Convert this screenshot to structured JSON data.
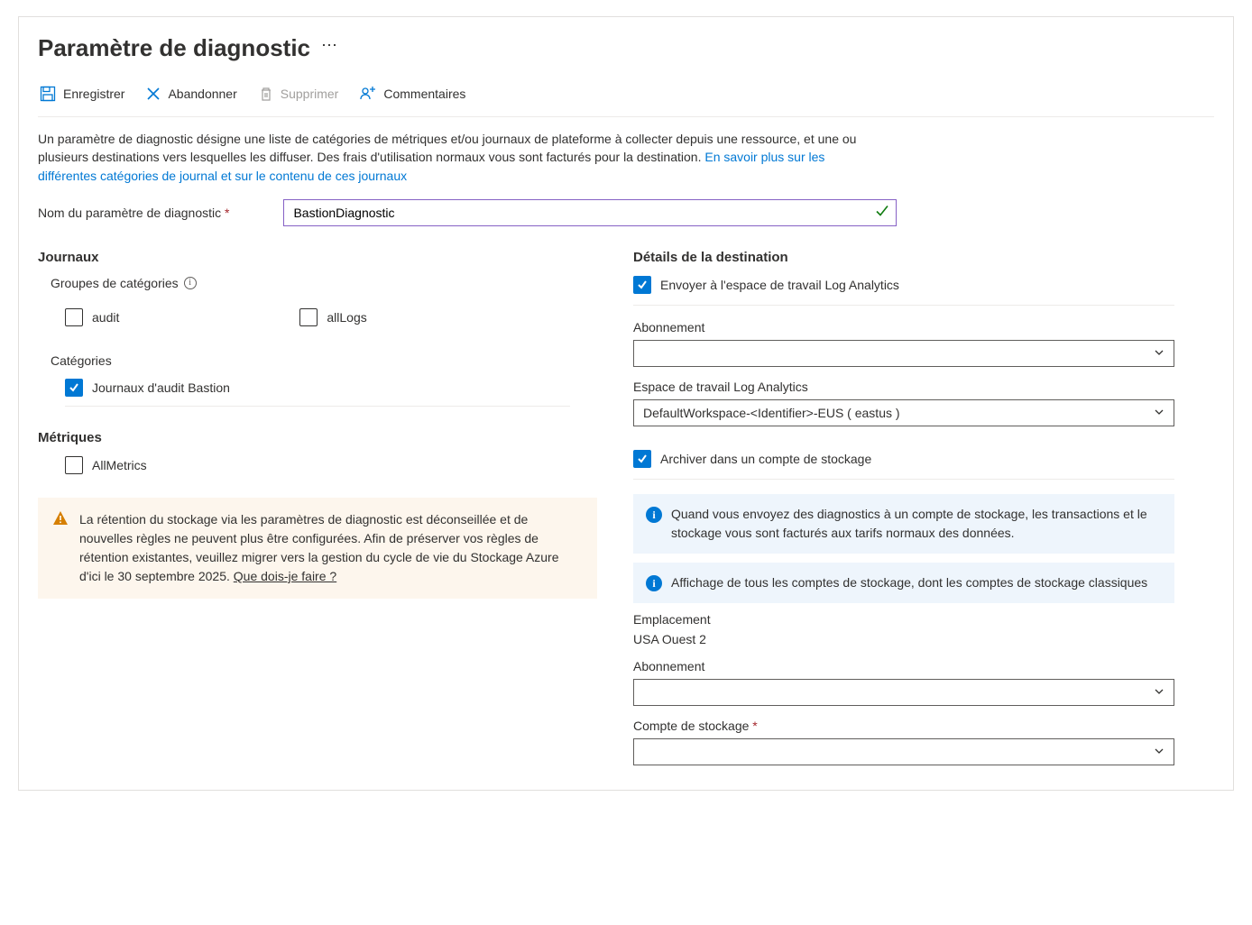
{
  "header": {
    "title": "Paramètre de diagnostic"
  },
  "toolbar": {
    "save": "Enregistrer",
    "discard": "Abandonner",
    "delete": "Supprimer",
    "feedback": "Commentaires"
  },
  "description": {
    "text": "Un paramètre de diagnostic désigne une liste de catégories de métriques et/ou journaux de plateforme à collecter depuis une ressource, et une ou plusieurs destinations vers lesquelles les diffuser. Des frais d'utilisation normaux vous sont facturés pour la destination. ",
    "link": "En savoir plus sur les différentes catégories de journal et sur le contenu de ces journaux"
  },
  "name": {
    "label": "Nom du paramètre de diagnostic",
    "value": "BastionDiagnostic"
  },
  "left": {
    "logs_title": "Journaux",
    "cat_groups_label": "Groupes de catégories",
    "audit": "audit",
    "alllogs": "allLogs",
    "categories_label": "Catégories",
    "bastion_audit": "Journaux d'audit Bastion",
    "metrics_title": "Métriques",
    "allmetrics": "AllMetrics"
  },
  "warning": {
    "text": "La rétention du stockage via les paramètres de diagnostic est déconseillée et de nouvelles règles ne peuvent plus être configurées. Afin de préserver vos règles de rétention existantes, veuillez migrer vers la gestion du cycle de vie du Stockage Azure d'ici le 30 septembre 2025. ",
    "link": "Que dois-je faire ?"
  },
  "right": {
    "dest_title": "Détails de la destination",
    "send_la": "Envoyer à l'espace de travail Log Analytics",
    "sub_label": "Abonnement",
    "sub_value": "",
    "workspace_label": "Espace de travail Log Analytics",
    "workspace_value": "DefaultWorkspace-<Identifier>-EUS ( eastus )",
    "archive_storage": "Archiver dans un compte de stockage",
    "info1": "Quand vous envoyez des diagnostics à un compte de stockage, les transactions et le stockage vous sont facturés aux tarifs normaux des données.",
    "info2": "Affichage de tous les comptes de stockage, dont les comptes de stockage classiques",
    "location_label": "Emplacement",
    "location_value": "USA Ouest 2",
    "sub2_label": "Abonnement",
    "sub2_value": "",
    "storage_label": "Compte de stockage",
    "storage_value": ""
  }
}
